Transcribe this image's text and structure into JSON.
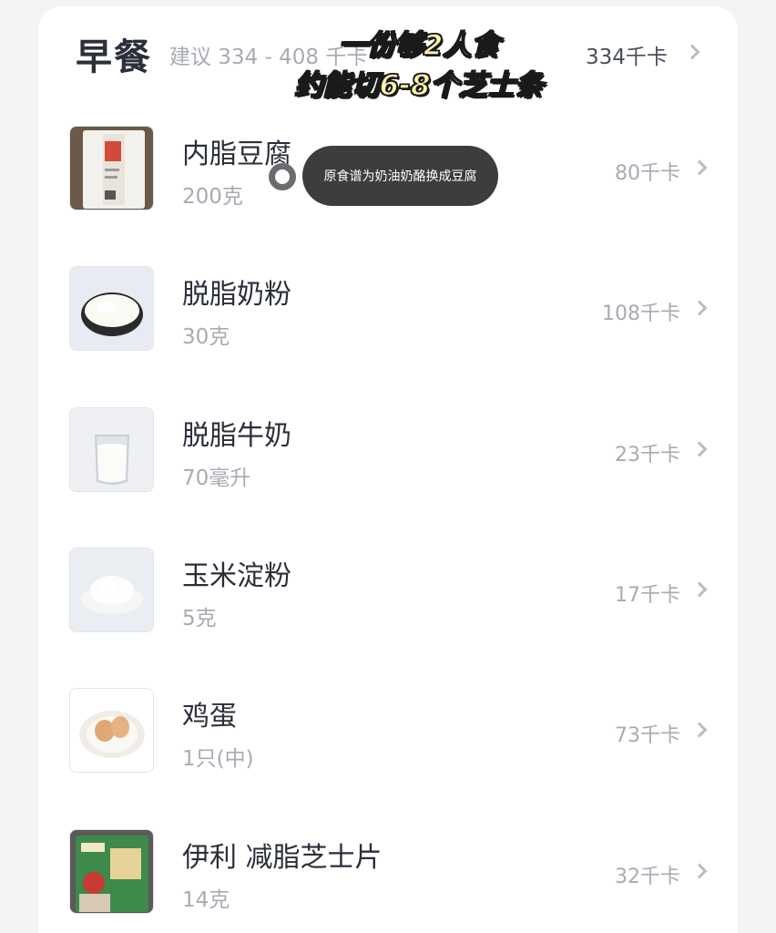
{
  "header": {
    "title": "早餐",
    "suggestion": "建议 334 - 408 千卡",
    "total": "334千卡"
  },
  "overlay": {
    "line1": "一份够2人食",
    "line2": "约能切6-8个芝士条"
  },
  "tooltip": {
    "text": "原食谱为奶油奶酪换成豆腐"
  },
  "items": [
    {
      "name": "内脂豆腐",
      "amount": "200克",
      "kcal": "80千卡",
      "image": "tofu-package"
    },
    {
      "name": "脱脂奶粉",
      "amount": "30克",
      "kcal": "108千卡",
      "image": "milk-powder-bowl"
    },
    {
      "name": "脱脂牛奶",
      "amount": "70毫升",
      "kcal": "23千卡",
      "image": "milk-glass"
    },
    {
      "name": "玉米淀粉",
      "amount": "5克",
      "kcal": "17千卡",
      "image": "cornstarch-pile"
    },
    {
      "name": "鸡蛋",
      "amount": "1只(中)",
      "kcal": "73千卡",
      "image": "eggs-on-plate"
    },
    {
      "name": "伊利 减脂芝士片",
      "amount": "14克",
      "kcal": "32千卡",
      "image": "cheese-slice-package"
    }
  ],
  "colors": {
    "background": "#f2f3f5",
    "card": "#ffffff",
    "title": "#2b2f3a",
    "muted": "#a7abb3",
    "tooltip_bg": "#3d3d3f",
    "overlay_text": "#fff3a8"
  }
}
